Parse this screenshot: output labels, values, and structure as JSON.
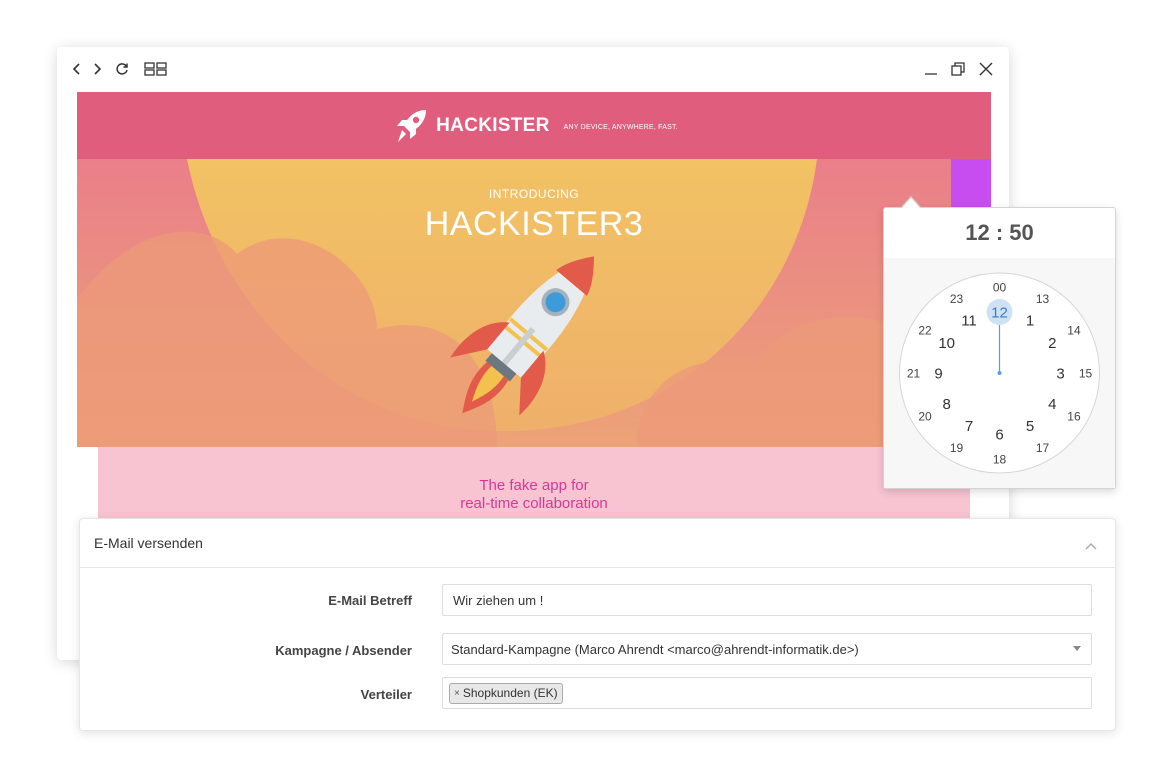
{
  "browser": {
    "nav_icons": [
      "back-icon",
      "forward-icon",
      "reload-icon",
      "tabs-icon"
    ],
    "window_icons": [
      "minimize-icon",
      "restore-icon",
      "close-icon"
    ]
  },
  "email": {
    "brand": "HACKISTER",
    "tagline": "ANY DEVICE, ANYWHERE, FAST.",
    "hero_intro": "INTRODUCING",
    "hero_title": "HACKISTER3",
    "tagline_line1": "The fake app for",
    "tagline_line2": "real-time collaboration",
    "colors": {
      "header": "#e05d7e",
      "sun": "#f2c263",
      "strip": "#c84df0",
      "pink": "#f8c4d2",
      "tagline_text": "#d8379a"
    }
  },
  "time_picker": {
    "time": "12 : 50",
    "selected_hour": "12",
    "outer_hours": [
      "12",
      "1",
      "2",
      "3",
      "4",
      "5",
      "6",
      "7",
      "8",
      "9",
      "10",
      "11"
    ],
    "inner_hours": [
      "00",
      "13",
      "14",
      "15",
      "16",
      "17",
      "18",
      "19",
      "20",
      "21",
      "22",
      "23"
    ],
    "accent": "#5a9ee0"
  },
  "form": {
    "title": "E-Mail versenden",
    "subject_label": "E-Mail Betreff",
    "subject_value": "Wir ziehen um !",
    "campaign_label": "Kampagne / Absender",
    "campaign_value": "Standard-Kampagne (Marco Ahrendt <marco@ahrendt-informatik.de>)",
    "distribution_label": "Verteiler",
    "distribution_tag": "Shopkunden (EK)",
    "tag_remove": "×"
  }
}
